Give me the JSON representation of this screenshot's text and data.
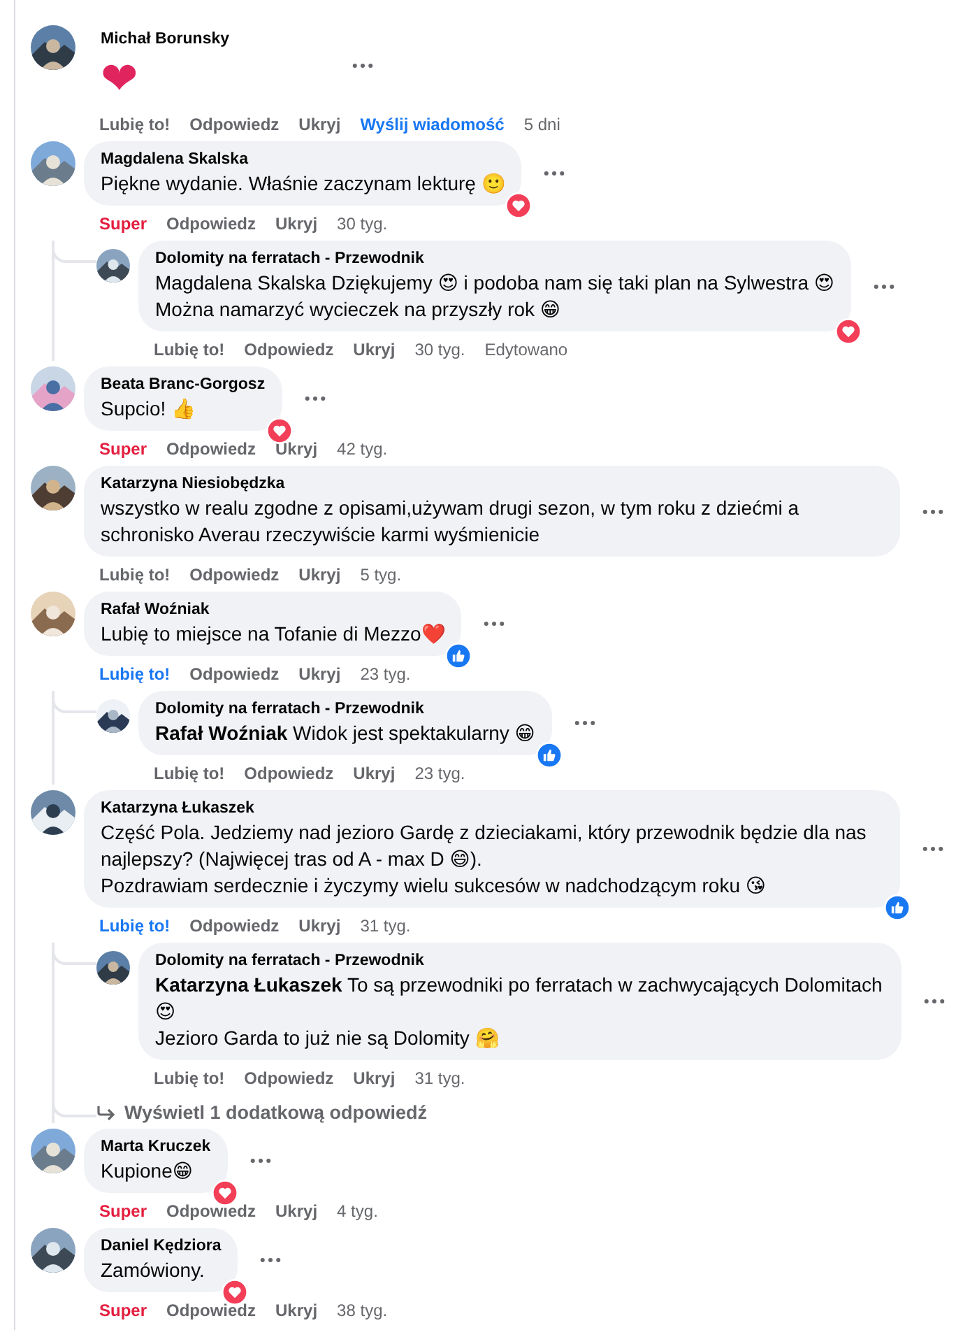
{
  "comments": [
    {
      "author": "Michał Borunsky",
      "kind": "emoji",
      "text": [
        "❤"
      ],
      "actions": [
        {
          "kind": "like",
          "label": "Lubię to!",
          "selected": false
        },
        {
          "kind": "link",
          "label": "Odpowiedz"
        },
        {
          "kind": "link",
          "label": "Ukryj"
        },
        {
          "kind": "message",
          "label": "Wyślij wiadomość"
        },
        {
          "kind": "time",
          "label": "5 dni"
        }
      ]
    },
    {
      "author": "Magdalena Skalska",
      "kind": "bubble",
      "text": [
        "Piękne wydanie. Właśnie zaczynam lekturę 🙂"
      ],
      "badge": {
        "kind": "love"
      },
      "actions": [
        {
          "kind": "love",
          "label": "Super",
          "selected": true
        },
        {
          "kind": "link",
          "label": "Odpowiedz"
        },
        {
          "kind": "link",
          "label": "Ukryj"
        },
        {
          "kind": "time",
          "label": "30 tyg."
        }
      ],
      "replies": [
        {
          "author": "Dolomity na ferratach - Przewodnik",
          "kind": "bubble",
          "text": [
            "Magdalena Skalska Dziękujemy 😍 i podoba nam się taki plan na Sylwestra 😍",
            "Można namarzyć wycieczek na przyszły rok 😁"
          ],
          "badge": {
            "kind": "love"
          },
          "actions": [
            {
              "kind": "like",
              "label": "Lubię to!",
              "selected": false
            },
            {
              "kind": "link",
              "label": "Odpowiedz"
            },
            {
              "kind": "link",
              "label": "Ukryj"
            },
            {
              "kind": "time",
              "label": "30 tyg."
            },
            {
              "kind": "time",
              "label": "Edytowano"
            }
          ]
        }
      ]
    },
    {
      "author": "Beata Branc-Gorgosz",
      "kind": "bubble",
      "text": [
        "Supcio! 👍"
      ],
      "badge": {
        "kind": "love"
      },
      "actions": [
        {
          "kind": "love",
          "label": "Super",
          "selected": true
        },
        {
          "kind": "link",
          "label": "Odpowiedz"
        },
        {
          "kind": "link",
          "label": "Ukryj"
        },
        {
          "kind": "time",
          "label": "42 tyg."
        }
      ]
    },
    {
      "author": "Katarzyna Niesiobędzka",
      "kind": "bubble",
      "text": [
        "wszystko w realu zgodne z opisami,używam drugi sezon, w tym roku z dziećmi a schronisko Averau rzeczywiście karmi wyśmienicie"
      ],
      "actions": [
        {
          "kind": "like",
          "label": "Lubię to!",
          "selected": false
        },
        {
          "kind": "link",
          "label": "Odpowiedz"
        },
        {
          "kind": "link",
          "label": "Ukryj"
        },
        {
          "kind": "time",
          "label": "5 tyg."
        }
      ]
    },
    {
      "author": "Rafał Woźniak",
      "kind": "bubble",
      "text": [
        "Lubię to miejsce na Tofanie di Mezzo❤️"
      ],
      "badge": {
        "kind": "like"
      },
      "actions": [
        {
          "kind": "like",
          "label": "Lubię to!",
          "selected": true
        },
        {
          "kind": "link",
          "label": "Odpowiedz"
        },
        {
          "kind": "link",
          "label": "Ukryj"
        },
        {
          "kind": "time",
          "label": "23 tyg."
        }
      ],
      "replies": [
        {
          "author": "Dolomity na ferratach - Przewodnik",
          "kind": "bubble",
          "text": [
            "**Rafał Woźniak** Widok jest spektakularny 😁"
          ],
          "badge": {
            "kind": "like"
          },
          "actions": [
            {
              "kind": "like",
              "label": "Lubię to!",
              "selected": false
            },
            {
              "kind": "link",
              "label": "Odpowiedz"
            },
            {
              "kind": "link",
              "label": "Ukryj"
            },
            {
              "kind": "time",
              "label": "23 tyg."
            }
          ]
        }
      ]
    },
    {
      "author": "Katarzyna Łukaszek",
      "kind": "bubble",
      "text": [
        "Część Pola. Jedziemy nad jezioro Gardę z dzieciakami, który przewodnik będzie dla nas najlepszy? (Najwięcej tras od A - max D 😄).",
        "Pozdrawiam serdecznie i życzymy wielu sukcesów w nadchodzącym roku 😘"
      ],
      "badge": {
        "kind": "like"
      },
      "actions": [
        {
          "kind": "like",
          "label": "Lubię to!",
          "selected": true
        },
        {
          "kind": "link",
          "label": "Odpowiedz"
        },
        {
          "kind": "link",
          "label": "Ukryj"
        },
        {
          "kind": "time",
          "label": "31 tyg."
        }
      ],
      "replies": [
        {
          "author": "Dolomity na ferratach - Przewodnik",
          "kind": "bubble",
          "text": [
            "**Katarzyna Łukaszek** To są przewodniki po ferratach w zachwycających Dolomitach 😍",
            "Jezioro Garda to już nie są Dolomity 🤗"
          ],
          "actions": [
            {
              "kind": "like",
              "label": "Lubię to!",
              "selected": false
            },
            {
              "kind": "link",
              "label": "Odpowiedz"
            },
            {
              "kind": "link",
              "label": "Ukryj"
            },
            {
              "kind": "time",
              "label": "31 tyg."
            }
          ]
        }
      ],
      "more_replies": "Wyświetl 1 dodatkową odpowiedź"
    },
    {
      "author": "Marta Kruczek",
      "kind": "bubble",
      "text": [
        "Kupione😁"
      ],
      "badge": {
        "kind": "love"
      },
      "actions": [
        {
          "kind": "love",
          "label": "Super",
          "selected": true
        },
        {
          "kind": "link",
          "label": "Odpowiedz"
        },
        {
          "kind": "link",
          "label": "Ukryj"
        },
        {
          "kind": "time",
          "label": "4 tyg."
        }
      ]
    },
    {
      "author": "Daniel Kędziora",
      "kind": "bubble",
      "text": [
        "Zamówiony."
      ],
      "badge": {
        "kind": "love"
      },
      "actions": [
        {
          "kind": "love",
          "label": "Super",
          "selected": true
        },
        {
          "kind": "link",
          "label": "Odpowiedz"
        },
        {
          "kind": "link",
          "label": "Ukryj"
        },
        {
          "kind": "time",
          "label": "38 tyg."
        }
      ]
    }
  ]
}
